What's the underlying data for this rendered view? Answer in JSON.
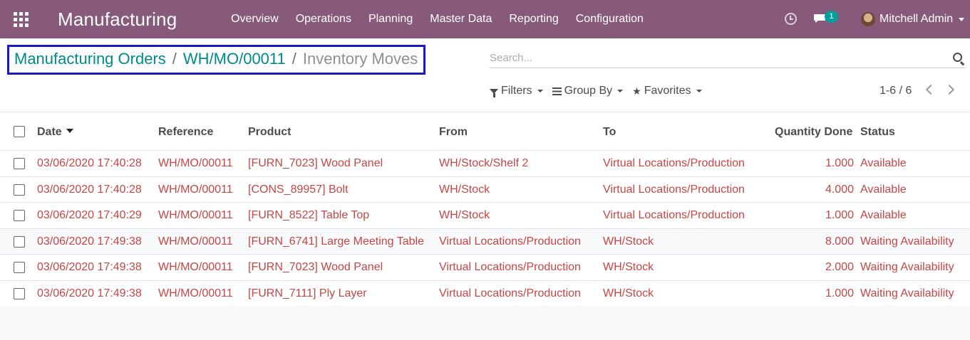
{
  "navbar": {
    "app_title": "Manufacturing",
    "menu": [
      {
        "label": "Overview"
      },
      {
        "label": "Operations"
      },
      {
        "label": "Planning"
      },
      {
        "label": "Master Data"
      },
      {
        "label": "Reporting"
      },
      {
        "label": "Configuration"
      }
    ],
    "chat_badge": "1",
    "user_name": "Mitchell Admin",
    "icons": {
      "apps": "apps-grid-icon",
      "activity": "clock-icon",
      "messages": "chat-icon",
      "user": "avatar"
    }
  },
  "breadcrumb": {
    "items": [
      "Manufacturing Orders",
      "WH/MO/00011"
    ],
    "separator": "/",
    "active": "Inventory Moves",
    "highlight_color": "#1a17c7"
  },
  "search": {
    "placeholder": "Search..."
  },
  "filters": {
    "filters_label": "Filters",
    "group_by_label": "Group By",
    "favorites_label": "Favorites"
  },
  "pager": {
    "text": "1-6 / 6"
  },
  "table": {
    "columns": [
      "Date",
      "Reference",
      "Product",
      "From",
      "To",
      "Quantity Done",
      "Status"
    ],
    "sort_column": "Date",
    "rows": [
      {
        "date": "03/06/2020 17:40:28",
        "reference": "WH/MO/00011",
        "product": "[FURN_7023] Wood Panel",
        "from": "WH/Stock/Shelf 2",
        "to": "Virtual Locations/Production",
        "qty": "1.000",
        "status": "Available"
      },
      {
        "date": "03/06/2020 17:40:28",
        "reference": "WH/MO/00011",
        "product": "[CONS_89957] Bolt",
        "from": "WH/Stock",
        "to": "Virtual Locations/Production",
        "qty": "4.000",
        "status": "Available"
      },
      {
        "date": "03/06/2020 17:40:29",
        "reference": "WH/MO/00011",
        "product": "[FURN_8522] Table Top",
        "from": "WH/Stock",
        "to": "Virtual Locations/Production",
        "qty": "1.000",
        "status": "Available"
      },
      {
        "date": "03/06/2020 17:49:38",
        "reference": "WH/MO/00011",
        "product": "[FURN_6741] Large Meeting Table",
        "from": "Virtual Locations/Production",
        "to": "WH/Stock",
        "qty": "8.000",
        "status": "Waiting Availability"
      },
      {
        "date": "03/06/2020 17:49:38",
        "reference": "WH/MO/00011",
        "product": "[FURN_7023] Wood Panel",
        "from": "Virtual Locations/Production",
        "to": "WH/Stock",
        "qty": "2.000",
        "status": "Waiting Availability"
      },
      {
        "date": "03/06/2020 17:49:38",
        "reference": "WH/MO/00011",
        "product": "[FURN_7111] Ply Layer",
        "from": "Virtual Locations/Production",
        "to": "WH/Stock",
        "qty": "1.000",
        "status": "Waiting Availability"
      }
    ]
  },
  "colors": {
    "navbar": "#875a7b",
    "link": "#00898a",
    "row_text": "#c64545",
    "badge": "#00a09d"
  }
}
